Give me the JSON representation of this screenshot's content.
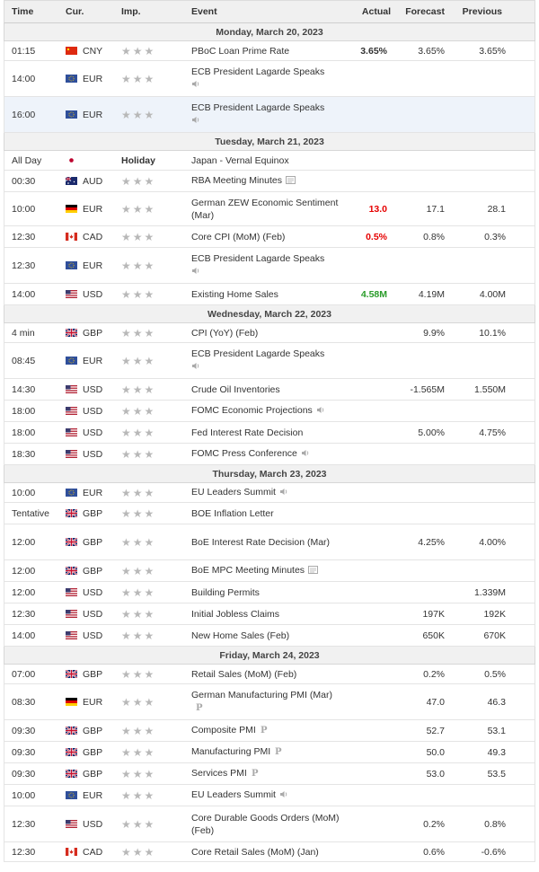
{
  "header": {
    "time": "Time",
    "cur": "Cur.",
    "imp": "Imp.",
    "event": "Event",
    "actual": "Actual",
    "forecast": "Forecast",
    "previous": "Previous"
  },
  "days": [
    {
      "label": "Monday, March 20, 2023",
      "rows": [
        {
          "time": "01:15",
          "cur": "CNY",
          "flag": "cn",
          "event": "PBoC Loan Prime Rate",
          "actual": "3.65%",
          "actual_color": "",
          "forecast": "3.65%",
          "previous": "3.65%",
          "h": 22
        },
        {
          "time": "14:00",
          "cur": "EUR",
          "flag": "eu",
          "event": "ECB President Lagarde Speaks",
          "icon": "speaker",
          "sub": true,
          "h": 40
        },
        {
          "time": "16:00",
          "cur": "EUR",
          "flag": "eu",
          "event": "ECB President Lagarde Speaks",
          "icon": "speaker",
          "sub": true,
          "h": 40,
          "hl": true
        }
      ]
    },
    {
      "label": "Tuesday, March 21, 2023",
      "rows": [
        {
          "time": "All Day",
          "cur": "",
          "flag": "jp",
          "holiday": "Holiday",
          "event": "Japan - Vernal Equinox",
          "h": 22
        },
        {
          "time": "00:30",
          "cur": "AUD",
          "flag": "au",
          "event": "RBA Meeting Minutes",
          "icon": "doc",
          "h": 24
        },
        {
          "time": "10:00",
          "cur": "EUR",
          "flag": "de",
          "event": "German ZEW Economic Sentiment (Mar)",
          "actual": "13.0",
          "actual_color": "red",
          "forecast": "17.1",
          "previous": "28.1",
          "h": 38
        },
        {
          "time": "12:30",
          "cur": "CAD",
          "flag": "ca",
          "event": "Core CPI (MoM) (Feb)",
          "actual": "0.5%",
          "actual_color": "red",
          "forecast": "0.8%",
          "previous": "0.3%",
          "h": 24
        },
        {
          "time": "12:30",
          "cur": "EUR",
          "flag": "eu",
          "event": "ECB President Lagarde Speaks",
          "icon": "speaker",
          "sub": true,
          "h": 40
        },
        {
          "time": "14:00",
          "cur": "USD",
          "flag": "us",
          "event": "Existing Home Sales",
          "actual": "4.58M",
          "actual_color": "green",
          "forecast": "4.19M",
          "previous": "4.00M",
          "h": 24
        }
      ]
    },
    {
      "label": "Wednesday, March 22, 2023",
      "rows": [
        {
          "time": "4 min",
          "cur": "GBP",
          "flag": "gb",
          "event": "CPI (YoY) (Feb)",
          "forecast": "9.9%",
          "previous": "10.1%",
          "h": 22
        },
        {
          "time": "08:45",
          "cur": "EUR",
          "flag": "eu",
          "event": "ECB President Lagarde Speaks",
          "icon": "speaker",
          "sub": true,
          "h": 40
        },
        {
          "time": "14:30",
          "cur": "USD",
          "flag": "us",
          "event": "Crude Oil Inventories",
          "forecast": "-1.565M",
          "previous": "1.550M",
          "h": 24
        },
        {
          "time": "18:00",
          "cur": "USD",
          "flag": "us",
          "event": "FOMC Economic Projections",
          "icon": "speaker",
          "h": 24
        },
        {
          "time": "18:00",
          "cur": "USD",
          "flag": "us",
          "event": "Fed Interest Rate Decision",
          "forecast": "5.00%",
          "previous": "4.75%",
          "h": 24
        },
        {
          "time": "18:30",
          "cur": "USD",
          "flag": "us",
          "event": "FOMC Press Conference",
          "icon": "speaker",
          "h": 24
        }
      ]
    },
    {
      "label": "Thursday, March 23, 2023",
      "rows": [
        {
          "time": "10:00",
          "cur": "EUR",
          "flag": "eu",
          "event": "EU Leaders Summit",
          "icon": "speaker",
          "h": 22
        },
        {
          "time": "Tentative",
          "cur": "GBP",
          "flag": "gb",
          "event": "BOE Inflation Letter",
          "h": 24
        },
        {
          "time": "12:00",
          "cur": "GBP",
          "flag": "gb",
          "event": "BoE Interest Rate Decision (Mar)",
          "forecast": "4.25%",
          "previous": "4.00%",
          "h": 40
        },
        {
          "time": "12:00",
          "cur": "GBP",
          "flag": "gb",
          "event": "BoE MPC Meeting Minutes",
          "icon": "doc",
          "h": 24
        },
        {
          "time": "12:00",
          "cur": "USD",
          "flag": "us",
          "event": "Building Permits",
          "previous": "1.339M",
          "h": 24
        },
        {
          "time": "12:30",
          "cur": "USD",
          "flag": "us",
          "event": "Initial Jobless Claims",
          "forecast": "197K",
          "previous": "192K",
          "h": 24
        },
        {
          "time": "14:00",
          "cur": "USD",
          "flag": "us",
          "event": "New Home Sales (Feb)",
          "forecast": "650K",
          "previous": "670K",
          "h": 24
        }
      ]
    },
    {
      "label": "Friday, March 24, 2023",
      "rows": [
        {
          "time": "07:00",
          "cur": "GBP",
          "flag": "gb",
          "event": "Retail Sales (MoM) (Feb)",
          "forecast": "0.2%",
          "previous": "0.5%",
          "h": 22
        },
        {
          "time": "08:30",
          "cur": "EUR",
          "flag": "de",
          "event": "German Manufacturing PMI (Mar)",
          "icon": "p",
          "forecast": "47.0",
          "previous": "46.3",
          "h": 40
        },
        {
          "time": "09:30",
          "cur": "GBP",
          "flag": "gb",
          "event": "Composite PMI",
          "icon": "p",
          "forecast": "52.7",
          "previous": "53.1",
          "h": 24
        },
        {
          "time": "09:30",
          "cur": "GBP",
          "flag": "gb",
          "event": "Manufacturing PMI",
          "icon": "p",
          "forecast": "50.0",
          "previous": "49.3",
          "h": 24
        },
        {
          "time": "09:30",
          "cur": "GBP",
          "flag": "gb",
          "event": "Services PMI",
          "icon": "p",
          "forecast": "53.0",
          "previous": "53.5",
          "h": 24
        },
        {
          "time": "10:00",
          "cur": "EUR",
          "flag": "eu",
          "event": "EU Leaders Summit",
          "icon": "speaker",
          "h": 24
        },
        {
          "time": "12:30",
          "cur": "USD",
          "flag": "us",
          "event": "Core Durable Goods Orders (MoM) (Feb)",
          "forecast": "0.2%",
          "previous": "0.8%",
          "h": 40
        },
        {
          "time": "12:30",
          "cur": "CAD",
          "flag": "ca",
          "event": "Core Retail Sales (MoM) (Jan)",
          "forecast": "0.6%",
          "previous": "-0.6%",
          "h": 22
        }
      ]
    }
  ],
  "colors": {
    "red": "#e60000",
    "green": "#2a9c2a",
    "star": "#b8b8b8",
    "highlight": "#eef3fa"
  }
}
